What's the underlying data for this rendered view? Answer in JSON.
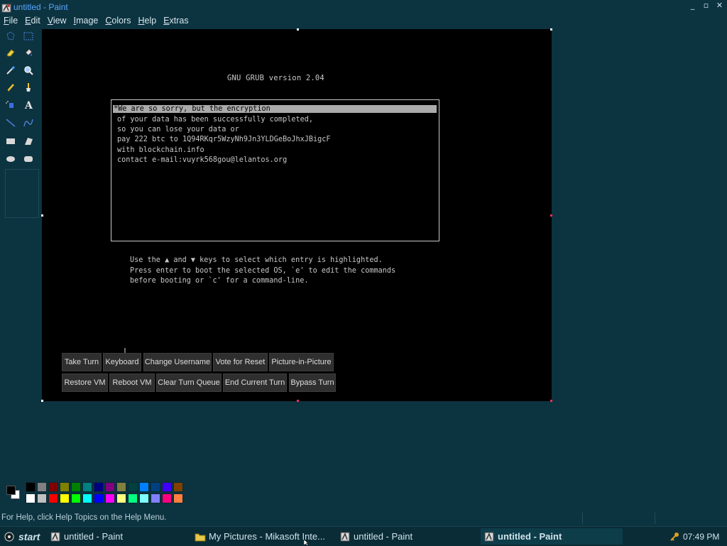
{
  "window": {
    "title": "untitled - Paint",
    "controls": [
      "_",
      "▫",
      "✕"
    ]
  },
  "menu": [
    "File",
    "Edit",
    "View",
    "Image",
    "Colors",
    "Help",
    "Extras"
  ],
  "tools": [
    {
      "name": "free-select-icon"
    },
    {
      "name": "rect-select-icon"
    },
    {
      "name": "eraser-icon"
    },
    {
      "name": "fill-icon"
    },
    {
      "name": "color-picker-icon"
    },
    {
      "name": "magnifier-icon"
    },
    {
      "name": "pencil-icon"
    },
    {
      "name": "brush-icon"
    },
    {
      "name": "airbrush-icon"
    },
    {
      "name": "text-icon"
    },
    {
      "name": "line-icon"
    },
    {
      "name": "curve-icon"
    },
    {
      "name": "rectangle-icon"
    },
    {
      "name": "polygon-icon"
    },
    {
      "name": "ellipse-icon"
    },
    {
      "name": "rounded-rect-icon"
    }
  ],
  "grub": {
    "title": "GNU GRUB  version 2.04",
    "entries": [
      "*We are so sorry, but the encryption",
      "of your data has been successfully completed,",
      "so you can lose your data or",
      "pay 222 btc to 1Q94RKqr5WzyNh9Jn3YLDGeBoJhxJBigcF",
      "with blockchain.info",
      "contact e-mail:vuyrk568gou@lelantos.org"
    ],
    "help": [
      "Use the ▲ and ▼ keys to select which entry is highlighted.",
      "Press enter to boot the selected OS, `e' to edit the commands",
      "before booting or `c' for a command-line."
    ]
  },
  "vm_buttons_row1": [
    "Take Turn",
    "Keyboard",
    "Change Username",
    "Vote for Reset",
    "Picture-in-Picture"
  ],
  "vm_buttons_row2": [
    "Restore VM",
    "Reboot VM",
    "Clear Turn Queue",
    "End Current Turn",
    "Bypass Turn"
  ],
  "palette": {
    "foreground": "#000000",
    "background": "#ffffff",
    "row1": [
      "#000000",
      "#808080",
      "#800000",
      "#808000",
      "#008000",
      "#008080",
      "#000080",
      "#800080",
      "#808040",
      "#004040",
      "#0080ff",
      "#004080",
      "#4000ff",
      "#804000"
    ],
    "row2": [
      "#ffffff",
      "#c0c0c0",
      "#ff0000",
      "#ffff00",
      "#00ff00",
      "#00ffff",
      "#0000ff",
      "#ff00ff",
      "#ffff80",
      "#00ff80",
      "#80ffff",
      "#8080ff",
      "#ff0080",
      "#ff8040"
    ]
  },
  "status": {
    "help_text": "For Help, click Help Topics on the Help Menu."
  },
  "taskbar": {
    "start_label": "start",
    "tasks": [
      {
        "label": "untitled - Paint",
        "active": false
      },
      {
        "label": "My Pictures - Mikasoft Inte...",
        "active": false
      },
      {
        "label": "untitled - Paint",
        "active": false
      },
      {
        "label": "untitled - Paint",
        "active": true
      }
    ],
    "clock": "07:49 PM"
  }
}
